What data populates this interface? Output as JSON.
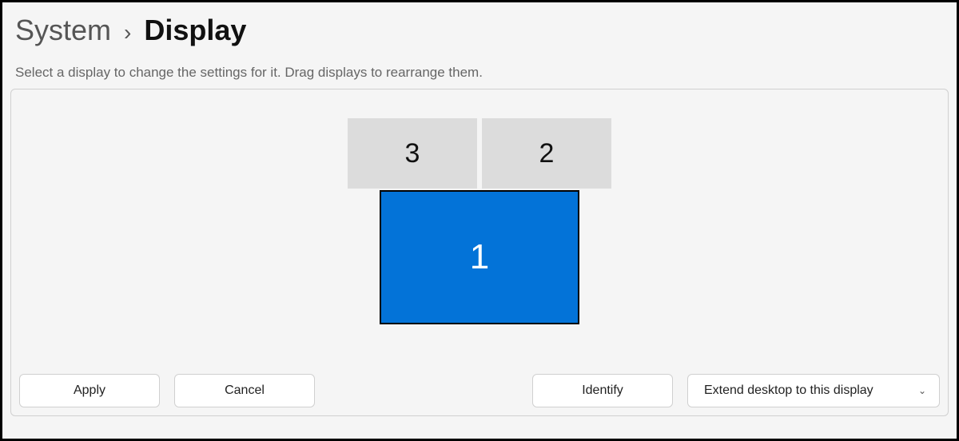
{
  "breadcrumb": {
    "parent": "System",
    "separator": "›",
    "current": "Display"
  },
  "instruction": "Select a display to change the settings for it. Drag displays to rearrange them.",
  "displays": {
    "top_left": "3",
    "top_right": "2",
    "bottom_selected": "1"
  },
  "buttons": {
    "apply": "Apply",
    "cancel": "Cancel",
    "identify": "Identify"
  },
  "dropdown": {
    "selected": "Extend desktop to this display"
  },
  "colors": {
    "accent_display": "#0373d8",
    "inactive_display": "#dcdcdc",
    "panel_border": "#d0d0d0",
    "page_bg": "#f5f5f5"
  }
}
